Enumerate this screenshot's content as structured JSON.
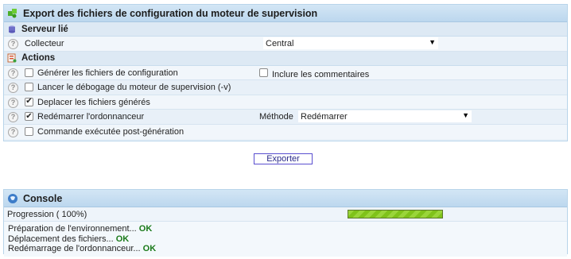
{
  "export": {
    "title": "Export des fichiers de configuration du moteur de supervision",
    "icon": "puzzle-green-icon",
    "server_section": {
      "title": "Serveur lié",
      "icon": "database-icon",
      "collector_label": "Collecteur",
      "collector_value": "Central"
    },
    "actions_section": {
      "title": "Actions",
      "icon": "list-orange-icon",
      "items": [
        {
          "label": "Générer les fichiers de configuration",
          "checked": false
        },
        {
          "label": "Lancer le débogage du moteur de supervision (-v)",
          "checked": false
        },
        {
          "label": "Deplacer les fichiers générés",
          "checked": true
        },
        {
          "label": "Redémarrer l'ordonnanceur",
          "checked": true
        },
        {
          "label": "Commande exécutée post-génération",
          "checked": false
        }
      ],
      "comments_label": "Inclure les commentaires",
      "comments_checked": false,
      "method_label": "Méthode",
      "method_value": "Redémarrer"
    },
    "export_button": "Exporter"
  },
  "console": {
    "title": "Console",
    "icon": "globe-icon",
    "progress_label": "Progression ( 100%)",
    "progress_value": 1.0,
    "log": [
      {
        "text": "Préparation de l'environnement...",
        "status": "OK"
      },
      {
        "text": "Déplacement des fichiers...",
        "status": "OK"
      },
      {
        "text": "Redémarrage de l'ordonnanceur...",
        "status": "OK"
      }
    ]
  },
  "colors": {
    "ok": "#1a7a1a",
    "progress": "#8ccc2a",
    "header": "#c8dff2"
  }
}
